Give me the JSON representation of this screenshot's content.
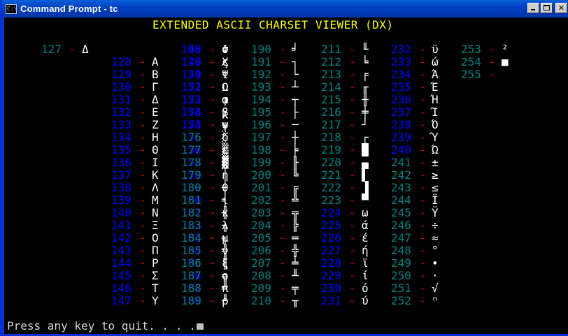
{
  "window": {
    "title": "Command Prompt - tc",
    "icon_text": "C:\\"
  },
  "header": "EXTENDED ASCII CHARSET VIEWER (DX)",
  "columns": [
    {
      "color": "cyan",
      "rows": [
        [
          "127",
          "Δ"
        ]
      ]
    },
    {
      "color": "blue",
      "rows": [
        [
          "128",
          "Α"
        ],
        [
          "129",
          "Β"
        ],
        [
          "130",
          "Γ"
        ],
        [
          "131",
          "Δ"
        ],
        [
          "132",
          "Ε"
        ],
        [
          "133",
          "Ζ"
        ],
        [
          "134",
          "Η"
        ],
        [
          "135",
          "Θ"
        ],
        [
          "136",
          "Ι"
        ],
        [
          "137",
          "Κ"
        ],
        [
          "138",
          "Λ"
        ],
        [
          "139",
          "Μ"
        ],
        [
          "140",
          "Ν"
        ],
        [
          "141",
          "Ξ"
        ],
        [
          "142",
          "Ο"
        ],
        [
          "143",
          "Π"
        ],
        [
          "144",
          "Ρ"
        ],
        [
          "145",
          "Σ"
        ],
        [
          "146",
          "Τ"
        ],
        [
          "147",
          "Υ"
        ]
      ]
    },
    {
      "color": "blue",
      "rows": [
        [
          "148",
          "Φ"
        ],
        [
          "149",
          "Χ"
        ],
        [
          "150",
          "Ψ"
        ],
        [
          "151",
          "Ω"
        ],
        [
          "152",
          "α"
        ],
        [
          "153",
          "β"
        ],
        [
          "154",
          "γ"
        ],
        [
          "155",
          "δ"
        ],
        [
          "156",
          "ε"
        ],
        [
          "157",
          "ζ"
        ],
        [
          "158",
          "η"
        ],
        [
          "159",
          "θ"
        ],
        [
          "160",
          "ι"
        ],
        [
          "161",
          "κ"
        ],
        [
          "162",
          "λ"
        ],
        [
          "163",
          "μ"
        ],
        [
          "164",
          "ν"
        ],
        [
          "165",
          "ξ"
        ],
        [
          "166",
          "ο"
        ],
        [
          "167",
          "π"
        ],
        [
          "168",
          "ρ"
        ]
      ]
    },
    {
      "color": "blue",
      "rows": [
        [
          "169",
          "σ"
        ],
        [
          "170",
          "ς"
        ],
        [
          "171",
          "τ"
        ],
        [
          "172",
          "υ"
        ],
        [
          "173",
          "φ"
        ],
        [
          "174",
          "χ"
        ],
        [
          "175",
          "ψ"
        ]
      ]
    },
    {
      "color": "cyan",
      "rows": [
        [
          "176",
          "░"
        ],
        [
          "177",
          "▒"
        ],
        [
          "178",
          "▓"
        ],
        [
          "179",
          "│"
        ],
        [
          "180",
          "┤"
        ],
        [
          "181",
          "╡"
        ],
        [
          "182",
          "╢"
        ],
        [
          "183",
          "╖"
        ],
        [
          "184",
          "╕"
        ],
        [
          "185",
          "╣"
        ],
        [
          "186",
          "║"
        ],
        [
          "187",
          "╗"
        ],
        [
          "188",
          "╝"
        ],
        [
          "189",
          "╜"
        ]
      ]
    },
    {
      "color": "cyan",
      "rows": [
        [
          "190",
          "╛"
        ],
        [
          "191",
          "┐"
        ],
        [
          "192",
          "└"
        ],
        [
          "193",
          "┴"
        ],
        [
          "194",
          "┬"
        ],
        [
          "195",
          "├"
        ],
        [
          "196",
          "─"
        ],
        [
          "197",
          "┼"
        ],
        [
          "198",
          "╞"
        ],
        [
          "199",
          "╟"
        ],
        [
          "200",
          "╚"
        ],
        [
          "201",
          "╔"
        ],
        [
          "202",
          "╩"
        ],
        [
          "203",
          "╦"
        ],
        [
          "204",
          "╠"
        ],
        [
          "205",
          "═"
        ],
        [
          "206",
          "╬"
        ],
        [
          "207",
          "╧"
        ],
        [
          "208",
          "╨"
        ],
        [
          "209",
          "╤"
        ],
        [
          "210",
          "╥"
        ]
      ]
    },
    {
      "color": "cyan",
      "rows": [
        [
          "211",
          "╙"
        ],
        [
          "212",
          "╘"
        ],
        [
          "213",
          "╒"
        ],
        [
          "214",
          "╓"
        ],
        [
          "215",
          "╫"
        ],
        [
          "216",
          "╪"
        ],
        [
          "217",
          "┘"
        ],
        [
          "218",
          "┌"
        ],
        [
          "219",
          "█"
        ],
        [
          "220",
          "▄"
        ],
        [
          "221",
          "▌"
        ],
        [
          "222",
          "▐"
        ],
        [
          "223",
          "▀"
        ]
      ]
    },
    {
      "color": "blue",
      "rows": [
        [
          "224",
          "ω"
        ],
        [
          "225",
          "ά"
        ],
        [
          "226",
          "έ"
        ],
        [
          "227",
          "ή"
        ],
        [
          "228",
          "ϊ"
        ],
        [
          "229",
          "ί"
        ],
        [
          "230",
          "ό"
        ],
        [
          "231",
          "ύ"
        ]
      ]
    },
    {
      "color": "blue",
      "rows": [
        [
          "232",
          "ϋ"
        ],
        [
          "233",
          "ώ"
        ],
        [
          "234",
          "Ά"
        ],
        [
          "235",
          "Έ"
        ],
        [
          "236",
          "Ή"
        ],
        [
          "237",
          "Ί"
        ],
        [
          "238",
          "Ό"
        ],
        [
          "239",
          "Ύ"
        ],
        [
          "240",
          "Ώ"
        ]
      ]
    },
    {
      "color": "cyan",
      "rows": [
        [
          "241",
          "±"
        ],
        [
          "242",
          "≥"
        ],
        [
          "243",
          "≤"
        ],
        [
          "244",
          "Ϊ"
        ],
        [
          "245",
          "Ϋ"
        ],
        [
          "246",
          "÷"
        ],
        [
          "247",
          "≈"
        ],
        [
          "248",
          "°"
        ],
        [
          "249",
          "∙"
        ],
        [
          "250",
          "·"
        ],
        [
          "251",
          "√"
        ],
        [
          "252",
          "ⁿ"
        ]
      ]
    },
    {
      "color": "cyan",
      "rows": [
        [
          "253",
          "²"
        ],
        [
          "254",
          "■"
        ],
        [
          "255",
          " "
        ]
      ]
    }
  ],
  "prompt": "Press any key to quit. . . ."
}
